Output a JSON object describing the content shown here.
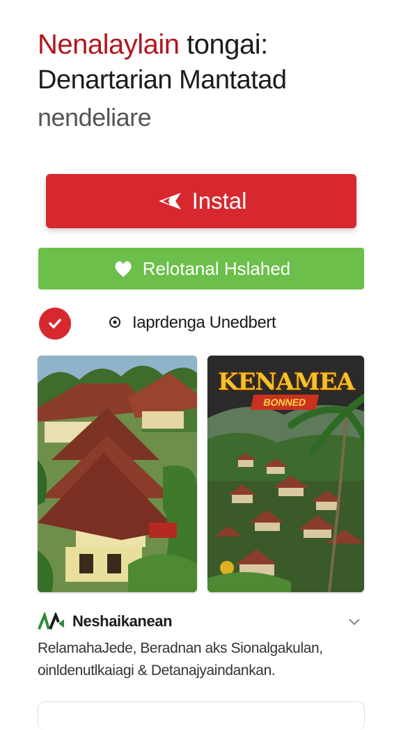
{
  "header": {
    "title_red": "Nenalaylain",
    "title_dark": " tongai:",
    "title_line2": "Denartarian Mantatad",
    "subtitle": "nendeliare"
  },
  "actions": {
    "install_label": "Instal",
    "secondary_label": "Relotanal Hslahed"
  },
  "verify": {
    "text": "Iaprdenga Unedbert"
  },
  "screenshots": {
    "banner_title": "KENAMEA",
    "banner_tag": "BONNED"
  },
  "developer": {
    "name": "Neshaikanean"
  },
  "description": {
    "line1": "RelamahaJede, Beradnan aks Sionalgakulan,",
    "line2": "oinldenutlkaiagi & Detanajyaindankan."
  },
  "colors": {
    "brand_red": "#d7282f",
    "title_red": "#b0161e",
    "secondary_green": "#6cbf4a"
  },
  "icons": {
    "install": "plane-icon",
    "secondary": "heart-icon",
    "verify": "check-icon",
    "radio": "radio-dot-icon",
    "expand": "chevron-down-icon"
  }
}
